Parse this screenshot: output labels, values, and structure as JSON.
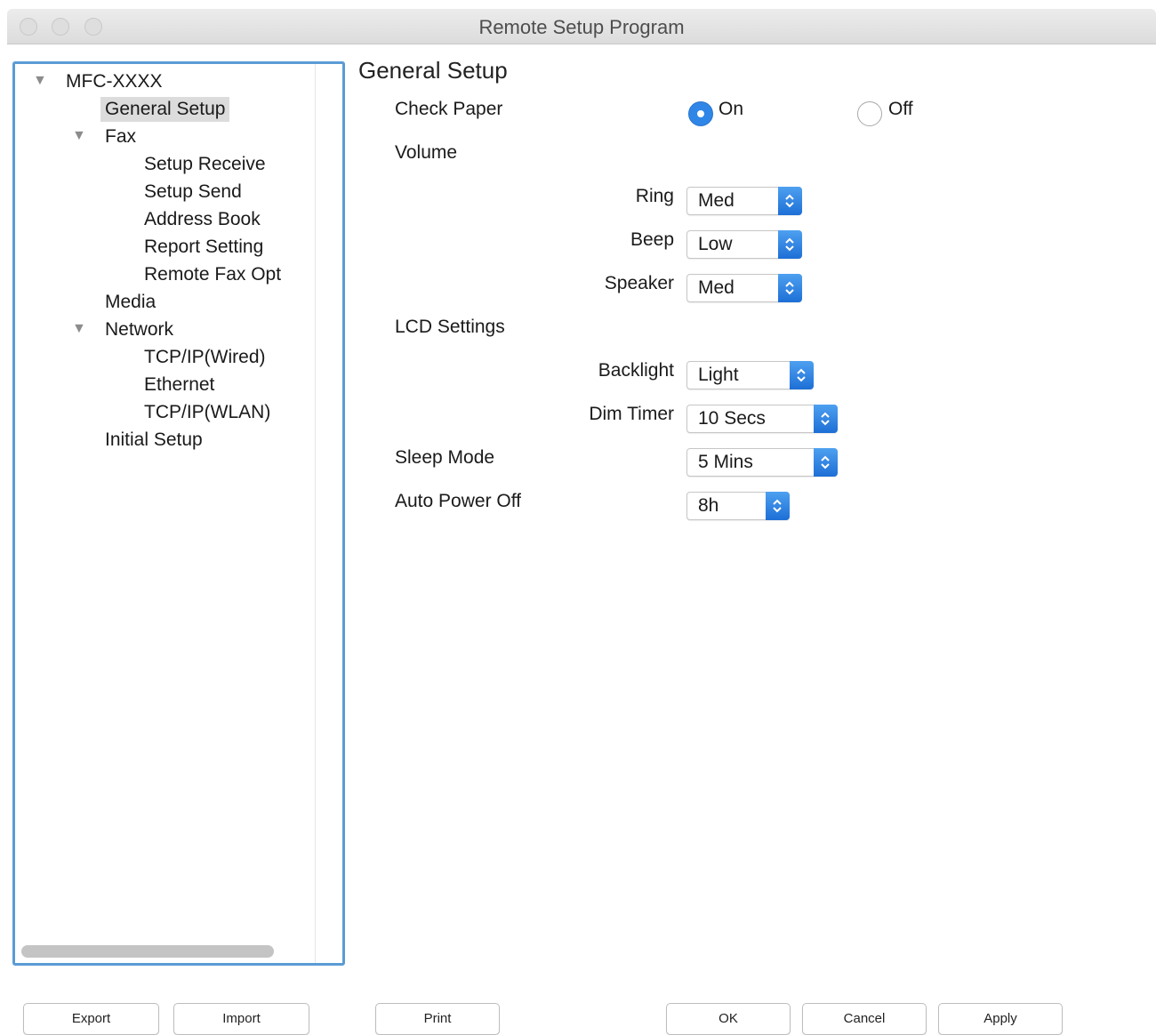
{
  "window": {
    "title": "Remote Setup Program"
  },
  "tree": {
    "root": "MFC-XXXX",
    "items": [
      "General Setup",
      "Fax",
      "Setup Receive",
      "Setup Send",
      "Address Book",
      "Report Setting",
      "Remote Fax Opt",
      "Media",
      "Network",
      "TCP/IP(Wired)",
      "Ethernet",
      "TCP/IP(WLAN)",
      "Initial Setup"
    ],
    "selected": "General Setup"
  },
  "panel": {
    "heading": "General Setup",
    "check_paper": {
      "label": "Check Paper",
      "on_label": "On",
      "off_label": "Off",
      "value": "On"
    },
    "volume": {
      "label": "Volume",
      "ring": {
        "label": "Ring",
        "value": "Med"
      },
      "beep": {
        "label": "Beep",
        "value": "Low"
      },
      "speaker": {
        "label": "Speaker",
        "value": "Med"
      }
    },
    "lcd": {
      "label": "LCD Settings",
      "backlight": {
        "label": "Backlight",
        "value": "Light"
      },
      "dim_timer": {
        "label": "Dim Timer",
        "value": "10 Secs"
      }
    },
    "sleep_mode": {
      "label": "Sleep Mode",
      "value": "5 Mins"
    },
    "auto_power_off": {
      "label": "Auto Power Off",
      "value": "8h"
    }
  },
  "buttons": {
    "export": "Export",
    "import": "Import",
    "print": "Print",
    "ok": "OK",
    "cancel": "Cancel",
    "apply": "Apply"
  },
  "colors": {
    "accent": "#2f86e6",
    "tree_border": "#5b9bd5",
    "selection": "#dcdcdc"
  }
}
